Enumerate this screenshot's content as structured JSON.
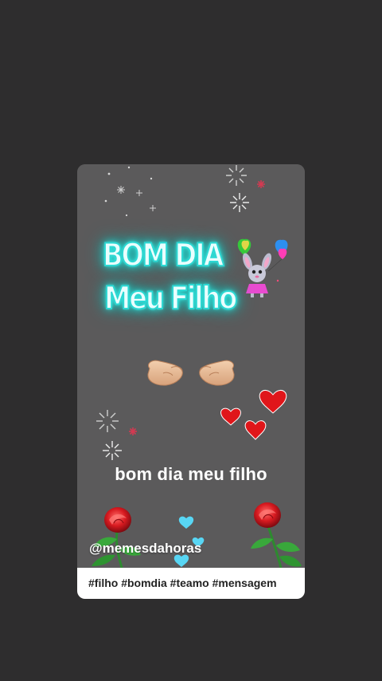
{
  "post": {
    "headline_line1": "BOM DIA",
    "headline_line2": "Meu Filho",
    "caption": "bom dia meu filho",
    "username": "@memesdahoras",
    "hashtags": "#filho #bomdia #teamo #mensagem"
  },
  "colors": {
    "background": "#2e2d2e",
    "media_background": "#5b5a5b",
    "neon_glow": "#2de0d8",
    "heart_red": "#e0161a",
    "heart_blue": "#58d6f4"
  },
  "icons": [
    "sparkle-icon",
    "firework-icon",
    "balloon-icon",
    "bunny-sticker-icon",
    "heart-hands-icon",
    "heart-icon",
    "rose-icon"
  ]
}
